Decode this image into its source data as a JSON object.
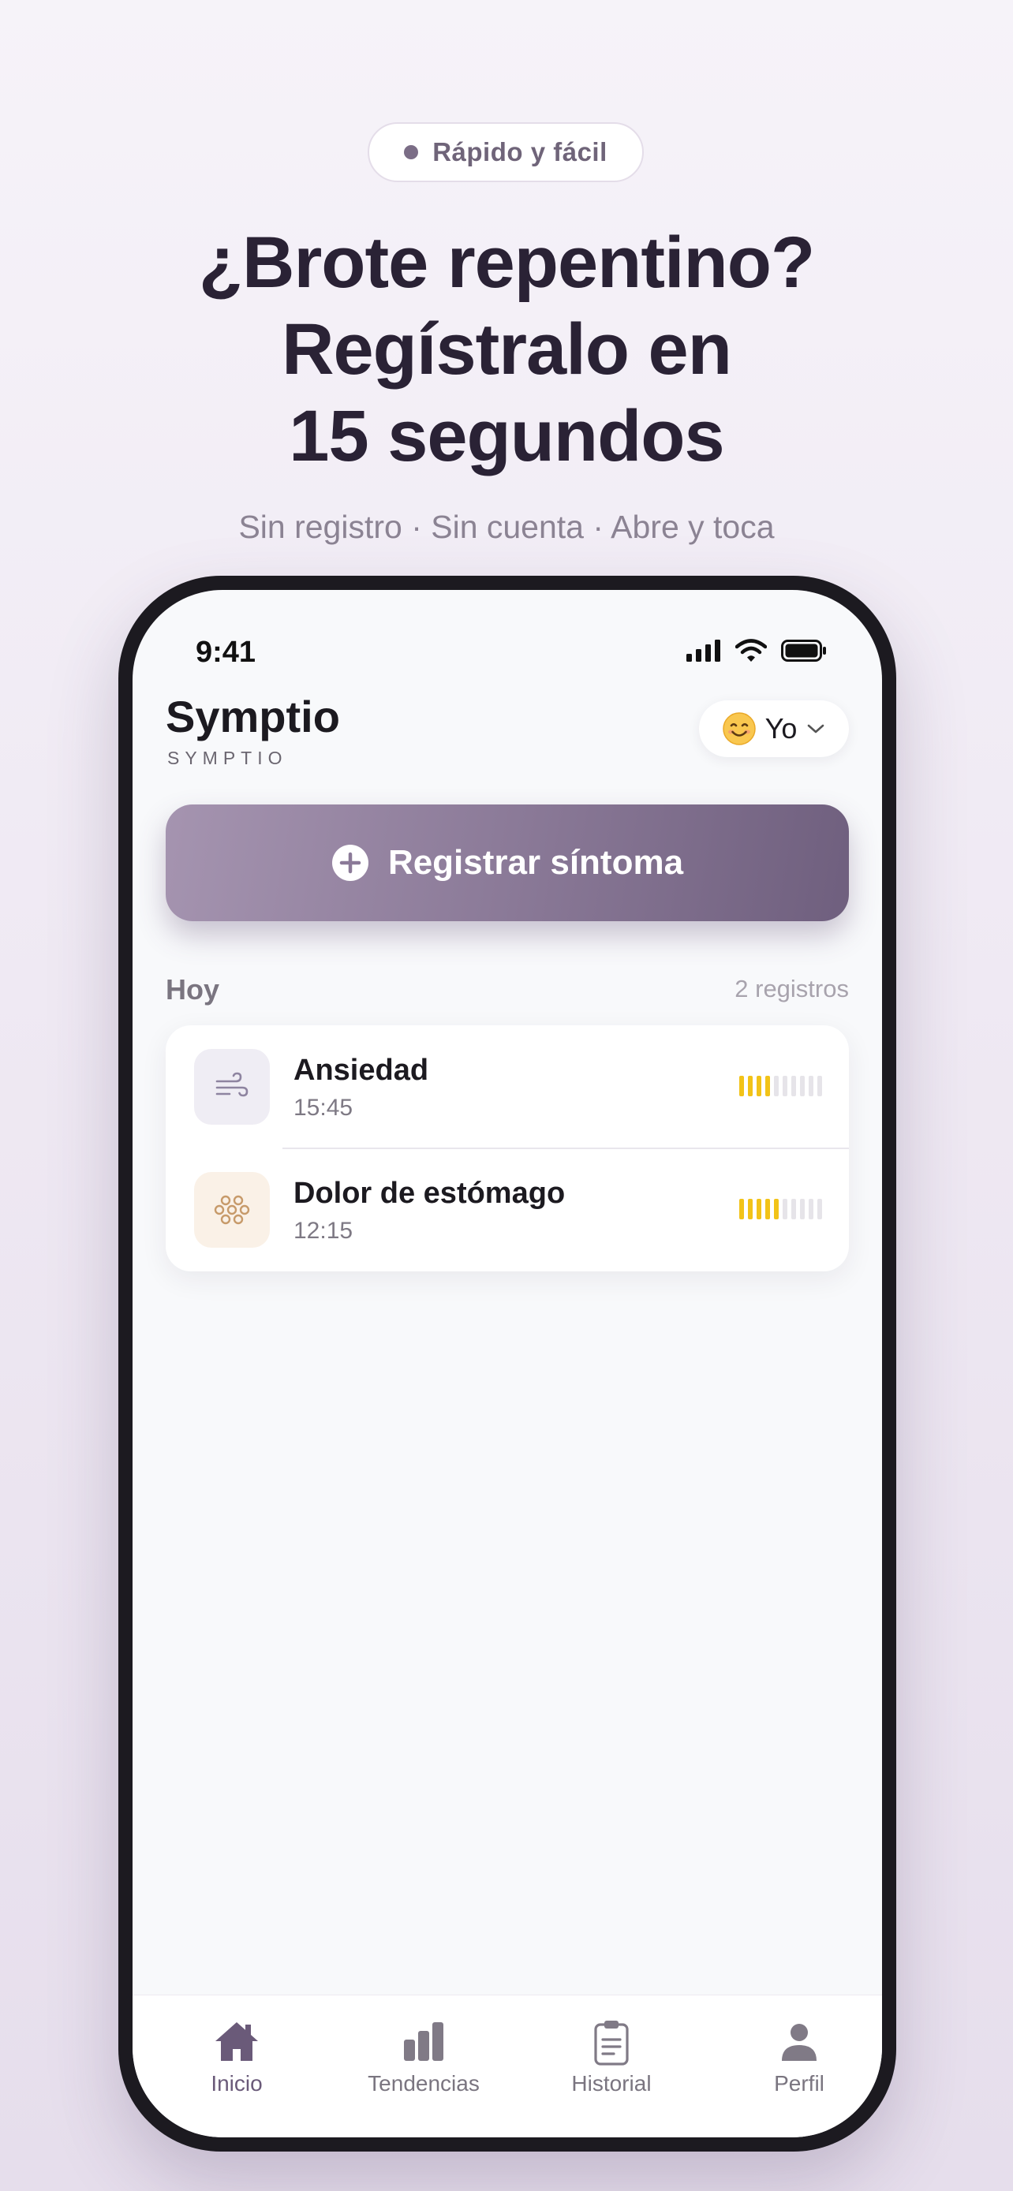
{
  "promo": {
    "badge": "Rápido y fácil",
    "headline_lines": [
      "¿Brote repentino?",
      "Regístralo en",
      "15 segundos"
    ],
    "subline": "Sin registro · Sin cuenta · Abre y toca"
  },
  "status_bar": {
    "time": "9:41"
  },
  "app": {
    "title": "Symptio",
    "subtitle": "SYMPTIO",
    "profile": {
      "name": "Yo",
      "emoji_icon": "smiling-face-icon"
    },
    "register_button_label": "Registrar síntoma"
  },
  "today": {
    "title": "Hoy",
    "count_label": "2 registros",
    "entries": [
      {
        "name": "Ansiedad",
        "time": "15:45",
        "icon": "wind-icon",
        "intensity": 4,
        "intensity_max": 10
      },
      {
        "name": "Dolor de estómago",
        "time": "12:15",
        "icon": "intestine-icon",
        "intensity": 5,
        "intensity_max": 10
      }
    ]
  },
  "tabs": [
    {
      "label": "Inicio",
      "icon": "home-icon",
      "active": true
    },
    {
      "label": "Tendencias",
      "icon": "bar-chart-icon",
      "active": false
    },
    {
      "label": "Historial",
      "icon": "clipboard-icon",
      "active": false
    },
    {
      "label": "Perfil",
      "icon": "person-icon",
      "active": false
    }
  ],
  "colors": {
    "accent": "#8b7a98",
    "intensity_on": "#f2c318",
    "intensity_off": "#e6e4e9"
  }
}
